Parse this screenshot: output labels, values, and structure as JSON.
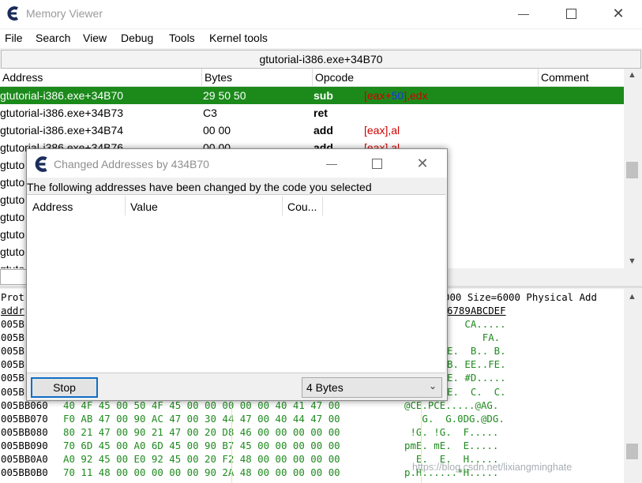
{
  "window": {
    "title": "Memory Viewer",
    "menu": [
      "File",
      "Search",
      "View",
      "Debug",
      "Tools",
      "Kernel tools"
    ]
  },
  "disassembler": {
    "address_bar": "gtutorial-i386.exe+34B70",
    "columns": [
      "Address",
      "Bytes",
      "Opcode",
      "Comment"
    ],
    "rows": [
      {
        "address": "gtutorial-i386.exe+34B70",
        "bytes": "29 50 50",
        "op": "sub",
        "args": [
          {
            "t": "[eax+",
            "c": "reg"
          },
          {
            "t": "50",
            "c": "num"
          },
          {
            "t": "],edx",
            "c": "reg"
          }
        ],
        "selected": true
      },
      {
        "address": "gtutorial-i386.exe+34B73",
        "bytes": "C3",
        "op": "ret",
        "args": []
      },
      {
        "address": "gtutorial-i386.exe+34B74",
        "bytes": "00 00",
        "op": "add",
        "args": [
          {
            "t": "[eax],al",
            "c": "reg"
          }
        ]
      },
      {
        "address": "gtutorial-i386.exe+34B76",
        "bytes": "00 00",
        "op": "add",
        "args": [
          {
            "t": "[eax],al",
            "c": "reg"
          }
        ]
      },
      {
        "address": "gtuto",
        "bytes": "",
        "op": "",
        "args": []
      },
      {
        "address": "gtuto",
        "bytes": "",
        "op": "",
        "args": []
      },
      {
        "address": "gtuto",
        "bytes": "",
        "op": "",
        "args": []
      },
      {
        "address": "gtuto",
        "bytes": "",
        "op": "",
        "args": []
      },
      {
        "address": "gtuto",
        "bytes": "",
        "op": "",
        "args": []
      },
      {
        "address": "gtuto",
        "bytes": "",
        "op": "",
        "args": []
      },
      {
        "address": "gtuto",
        "bytes": "",
        "op": "",
        "args": []
      }
    ]
  },
  "hexview": {
    "header1_left": "Prot",
    "header1_right": "000 Size=6000 Physical Add",
    "header2_left": "addr",
    "header2_right": "6789ABCDEF",
    "partial_rows": [
      {
        "addr": "005B",
        "ascii": "   CA....."
      },
      {
        "addr": "005B",
        "ascii": "      FA."
      },
      {
        "addr": "005B",
        "ascii": "E.  B.. B."
      },
      {
        "addr": "005B",
        "ascii": "B. EE..FE."
      },
      {
        "addr": "005B",
        "ascii": "E. #D....."
      },
      {
        "addr": "005B",
        "ascii": "E.  C.  C."
      }
    ],
    "rows": [
      {
        "addr": "005BB060",
        "bytes": "40 4F 45 00 50 4F 45 00 00 00 00 00 40 41 47 00",
        "ascii": "@CE.PCE.....@AG."
      },
      {
        "addr": "005BB070",
        "bytes": "F0 AB 47 00 90 AC 47 00 30 44 47 00 40 44 47 00",
        "ascii": "   G.  G.0DG.@DG."
      },
      {
        "addr": "005BB080",
        "bytes": "80 21 47 00 90 21 47 00 20 D8 46 00 00 00 00 00",
        "ascii": " !G. !G.  F....."
      },
      {
        "addr": "005BB090",
        "bytes": "70 6D 45 00 A0 6D 45 00 90 B7 45 00 00 00 00 00",
        "ascii": "pmE. mE.  E....."
      },
      {
        "addr": "005BB0A0",
        "bytes": "A0 92 45 00 E0 92 45 00 20 F2 48 00 00 00 00 00",
        "ascii": "  E.  E.  H....."
      },
      {
        "addr": "005BB0B0",
        "bytes": "70 11 48 00 00 00 00 00 90 2A 48 00 00 00 00 00",
        "ascii": "p.H......*H....."
      }
    ],
    "watermark": "https://blog.csdn.net/lixiangminghate"
  },
  "dialog": {
    "title": "Changed Addresses by 434B70",
    "message": "The following addresses have been changed by the code you selected",
    "columns": [
      "Address",
      "Value",
      "Cou..."
    ],
    "stop_label": "Stop",
    "size_value": "4 Bytes"
  }
}
